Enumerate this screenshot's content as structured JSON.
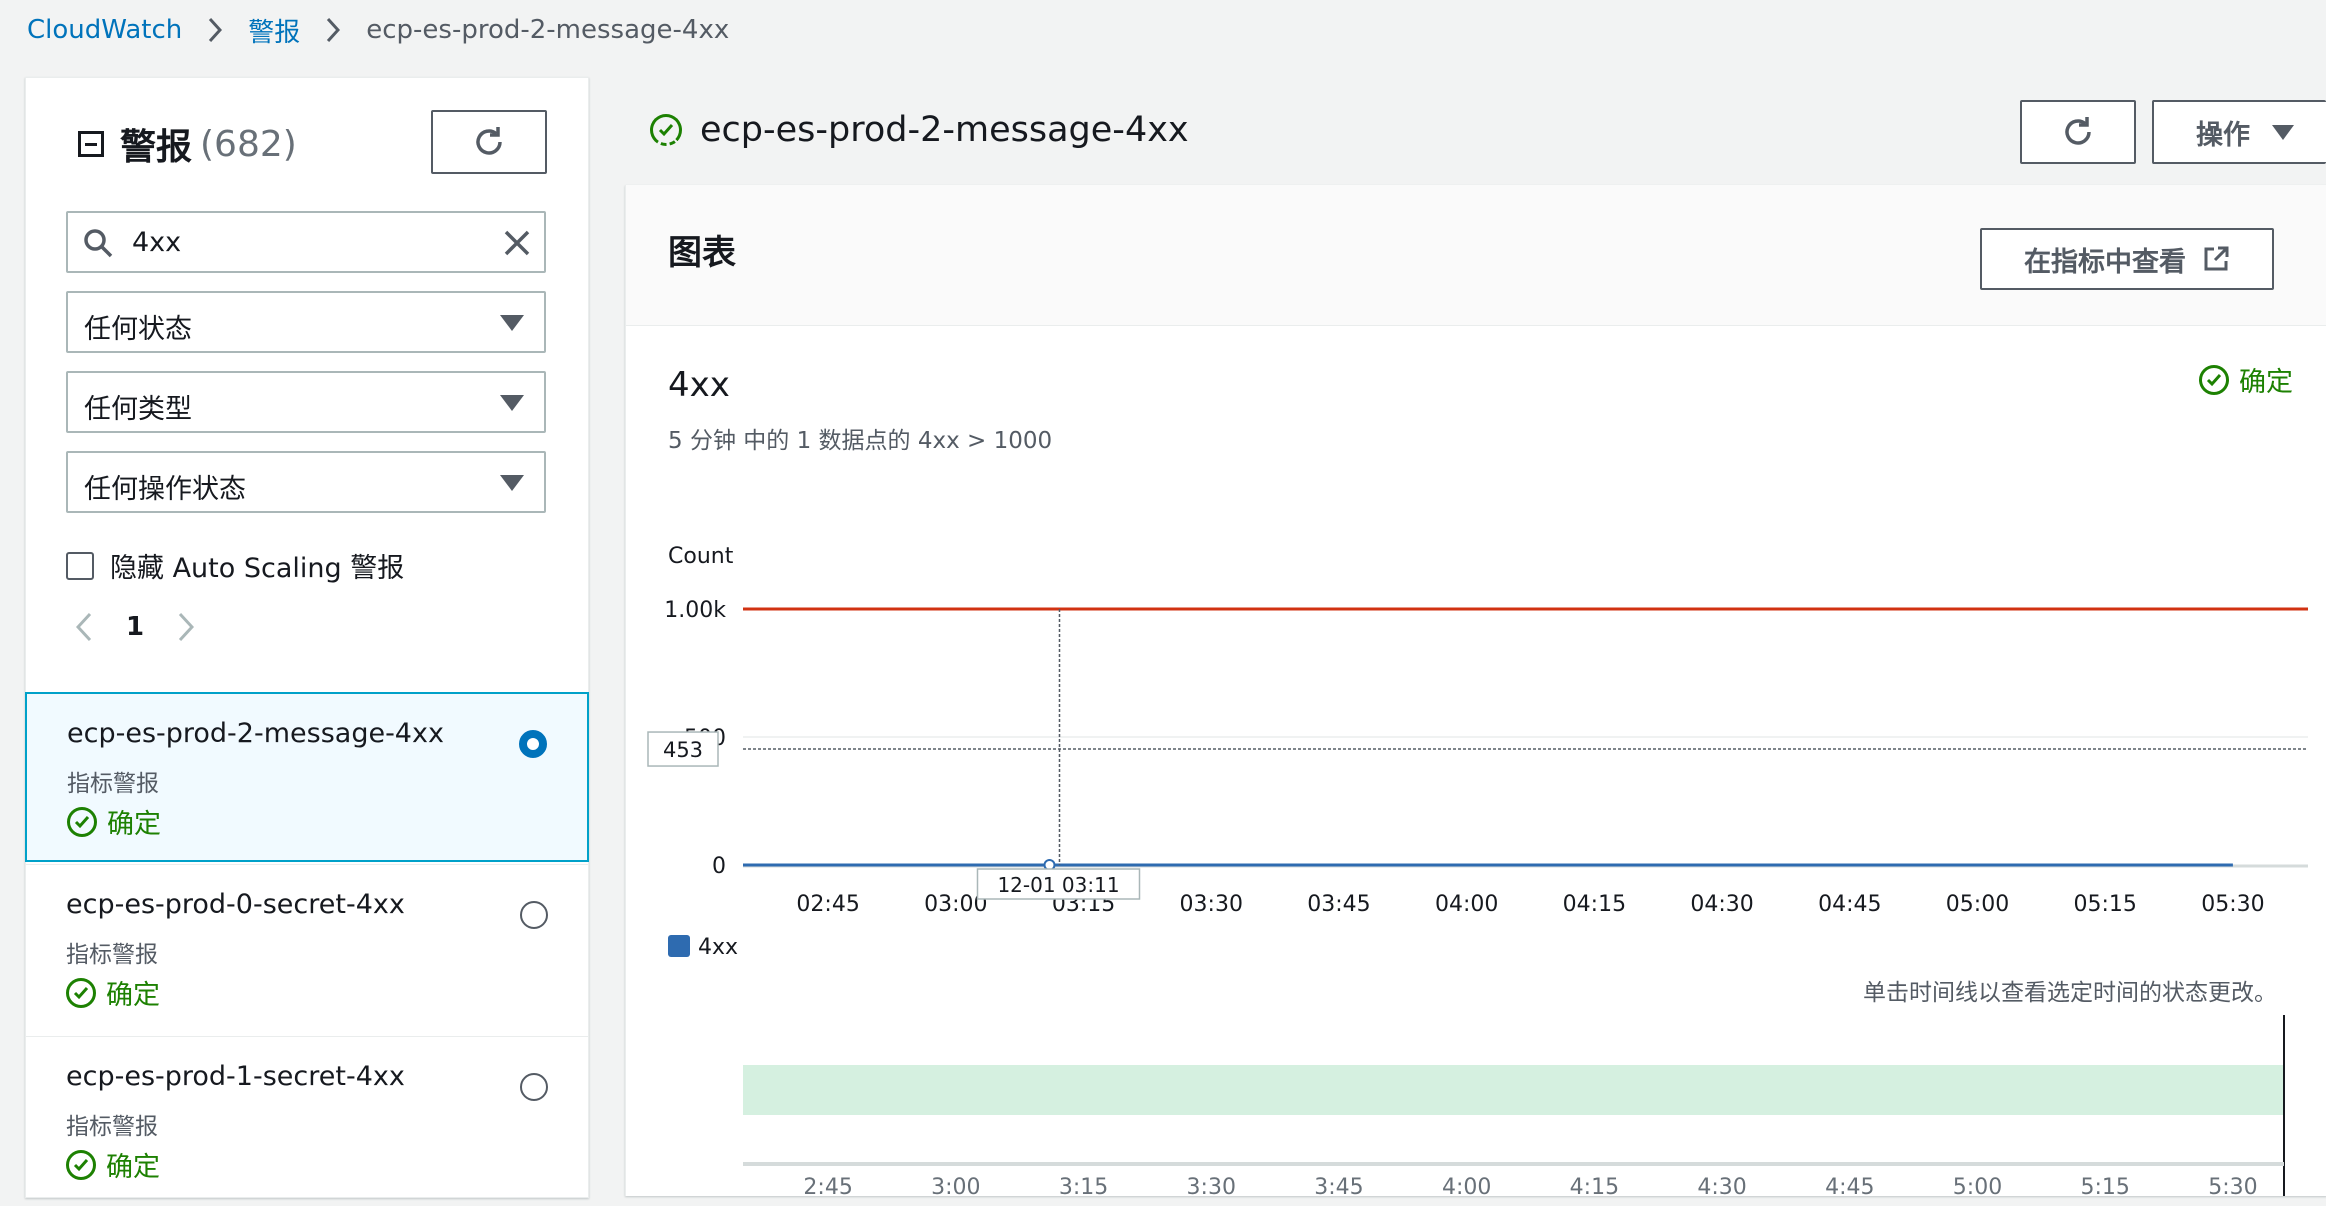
{
  "breadcrumb": {
    "items": [
      "CloudWatch",
      "警报"
    ],
    "current": "ecp-es-prod-2-message-4xx"
  },
  "sidebar": {
    "title": "警报",
    "count": "(682)",
    "search": {
      "value": "4xx"
    },
    "filters": [
      "任何状态",
      "任何类型",
      "任何操作状态"
    ],
    "hide_autoscaling_label": "隐藏 Auto Scaling 警报",
    "page": "1",
    "alarms": [
      {
        "name": "ecp-es-prod-2-message-4xx",
        "type": "指标警报",
        "state": "确定",
        "selected": true
      },
      {
        "name": "ecp-es-prod-0-secret-4xx",
        "type": "指标警报",
        "state": "确定",
        "selected": false
      },
      {
        "name": "ecp-es-prod-1-secret-4xx",
        "type": "指标警报",
        "state": "确定",
        "selected": false
      }
    ]
  },
  "detail": {
    "title": "ecp-es-prod-2-message-4xx",
    "actions_label": "操作",
    "card_title": "图表",
    "view_in_metrics_label": "在指标中查看",
    "metric_title": "4xx",
    "metric_subtitle": "5 分钟 中的 1 数据点的 4xx > 1000",
    "state_label": "确定",
    "timeline_hint": "单击时间线以查看选定时间的状态更改。"
  },
  "colors": {
    "ok": "#1d8102",
    "threshold": "#d13212",
    "series": "#2e6bb0",
    "accent": "#0073bb",
    "timeline_ok": "#d5f0e0"
  },
  "chart_data": {
    "type": "line",
    "ylabel": "Count",
    "y_ticks": [
      "0",
      "500",
      "1.00k"
    ],
    "ylim": [
      0,
      1000
    ],
    "x": [
      "02:45",
      "03:00",
      "03:15",
      "03:30",
      "03:45",
      "04:00",
      "04:15",
      "04:30",
      "04:45",
      "05:00",
      "05:15",
      "05:30"
    ],
    "xlim": [
      "02:35",
      "05:36"
    ],
    "series": [
      {
        "name": "4xx",
        "values": [
          0,
          0,
          0,
          0,
          0,
          0,
          0,
          0,
          0,
          0,
          0,
          0
        ]
      }
    ],
    "threshold": 1000,
    "cursor": {
      "x_label": "12-01 03:11",
      "y_label": "453",
      "x": "03:11",
      "y": 453
    },
    "legend": [
      "4xx"
    ],
    "timeline_ticks": [
      "2:45",
      "3:00",
      "3:15",
      "3:30",
      "3:45",
      "4:00",
      "4:15",
      "4:30",
      "4:45",
      "5:00",
      "5:15",
      "5:30"
    ]
  }
}
